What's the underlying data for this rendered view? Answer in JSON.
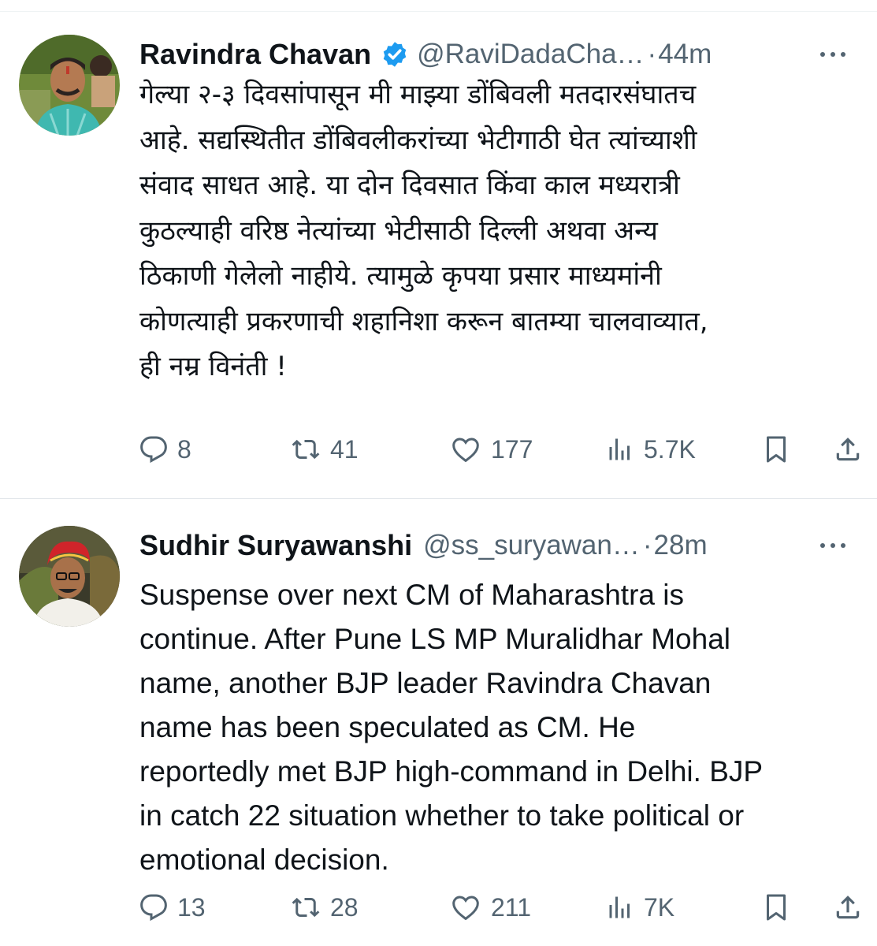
{
  "tweets": [
    {
      "author_name": "Ravindra Chavan",
      "verified": true,
      "handle": "@RaviDadaCha…",
      "separator": "·",
      "time": "44m",
      "text_lines": [
        "गेल्या २-३ दिवसांपासून मी माझ्या डोंबिवली मतदारसंघातच",
        "आहे. सद्यस्थितीत डोंबिवलीकरांच्या भेटीगाठी घेत त्यांच्याशी",
        "संवाद साधत आहे. या दोन दिवसात किंवा काल मध्यरात्री",
        "कुठल्याही वरिष्ठ नेत्यांच्या भेटीसाठी दिल्ली अथवा अन्य",
        "ठिकाणी गेलेलो नाहीये. त्यामुळे कृपया प्रसार माध्यमांनी",
        "कोणत्याही प्रकरणाची शहानिशा करून बातम्या चालवाव्यात,",
        "ही नम्र विनंती !"
      ],
      "stats": {
        "replies": "8",
        "reposts": "41",
        "likes": "177",
        "views": "5.7K"
      }
    },
    {
      "author_name": "Sudhir Suryawanshi",
      "verified": false,
      "handle": "@ss_suryawan…",
      "separator": "·",
      "time": "28m",
      "text_lines": [
        "Suspense over next CM of Maharashtra is",
        "continue. After Pune LS MP Muralidhar Mohal",
        "name,  another BJP leader Ravindra Chavan",
        "name has been speculated as CM. He",
        "reportedly met BJP high-command in Delhi.  BJP",
        "in catch 22 situation whether to take political or",
        "emotional decision."
      ],
      "stats": {
        "replies": "13",
        "reposts": "28",
        "likes": "211",
        "views": "7K"
      }
    }
  ],
  "colors": {
    "text_primary": "#0f1419",
    "text_secondary": "#536471",
    "verified_badge": "#1d9bf0",
    "divider": "#e1e6ea"
  },
  "icons": [
    "more-icon",
    "reply-icon",
    "repost-icon",
    "like-icon",
    "views-icon",
    "bookmark-icon",
    "share-icon",
    "verified-badge-icon"
  ]
}
